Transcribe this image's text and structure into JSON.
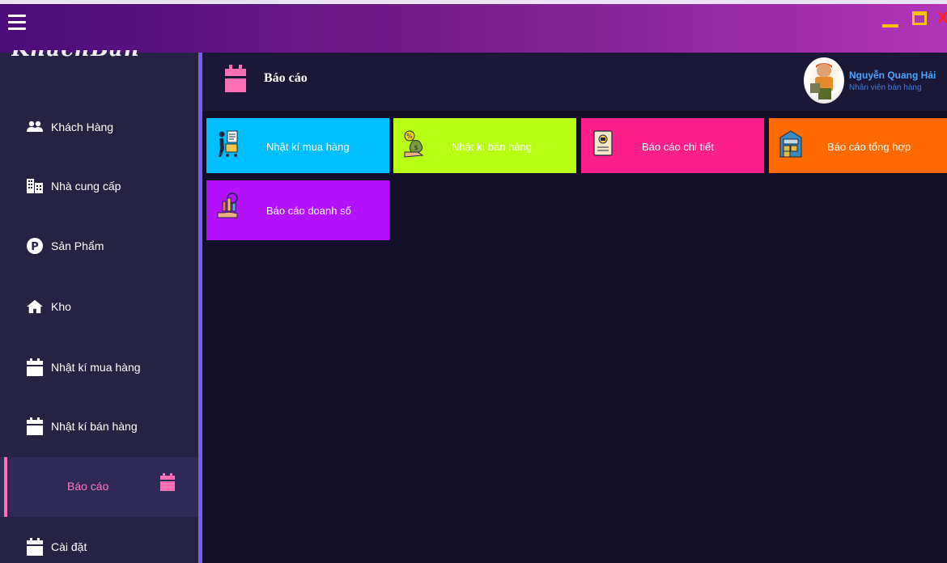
{
  "app": {
    "logo_text": "KhachBan"
  },
  "window_controls": {
    "close_label": "X"
  },
  "sidebar": {
    "items": [
      {
        "label": "Khách Hàng",
        "icon": "users-icon"
      },
      {
        "label": "Nhà cung cấp",
        "icon": "building-icon"
      },
      {
        "label": "Sản Phẩm",
        "icon": "product-p-icon"
      },
      {
        "label": "Kho",
        "icon": "home-icon"
      },
      {
        "label": "Nhật kí mua hàng",
        "icon": "calendar-icon"
      },
      {
        "label": "Nhật kí bán hàng",
        "icon": "calendar-icon"
      },
      {
        "label": "Báo cáo",
        "icon": "calendar-icon",
        "active": true
      },
      {
        "label": "Cài đặt",
        "icon": "calendar-icon"
      }
    ]
  },
  "header": {
    "title": "Báo cáo",
    "user_name": "Nguyễn Quang Hải",
    "user_role": "Nhân viên bán hàng"
  },
  "tiles": [
    {
      "label": "Nhật kí mua hàng",
      "color": "#00bfff",
      "icon": "shopping-cart-receipt-icon",
      "label_color": "#ffffff"
    },
    {
      "label": "Nhật kí bán hàng",
      "color": "#b8ff14",
      "icon": "money-bag-hand-icon",
      "label_color": "#ffffff"
    },
    {
      "label": "Báo cáo chi tiết",
      "color": "#ff1f8a",
      "icon": "certificate-scroll-icon",
      "label_color": "#ffffff"
    },
    {
      "label": "Báo cáo tổng hợp",
      "color": "#ff6a00",
      "icon": "warehouse-icon",
      "label_color": "#ffffff"
    },
    {
      "label": "Báo cáo doanh số",
      "color": "#b412ff",
      "icon": "sales-chart-hand-icon",
      "label_color": "#ffffff"
    }
  ],
  "colors": {
    "titlebar_start": "#4a0c7a",
    "titlebar_end": "#b035b8",
    "sidebar_bg": "#252243",
    "content_bg": "#140f28",
    "accent_pink": "#ff6fb5",
    "accent_purple": "#7b5cf0",
    "window_control_yellow": "#f5c200",
    "close_red": "#ff2020"
  }
}
